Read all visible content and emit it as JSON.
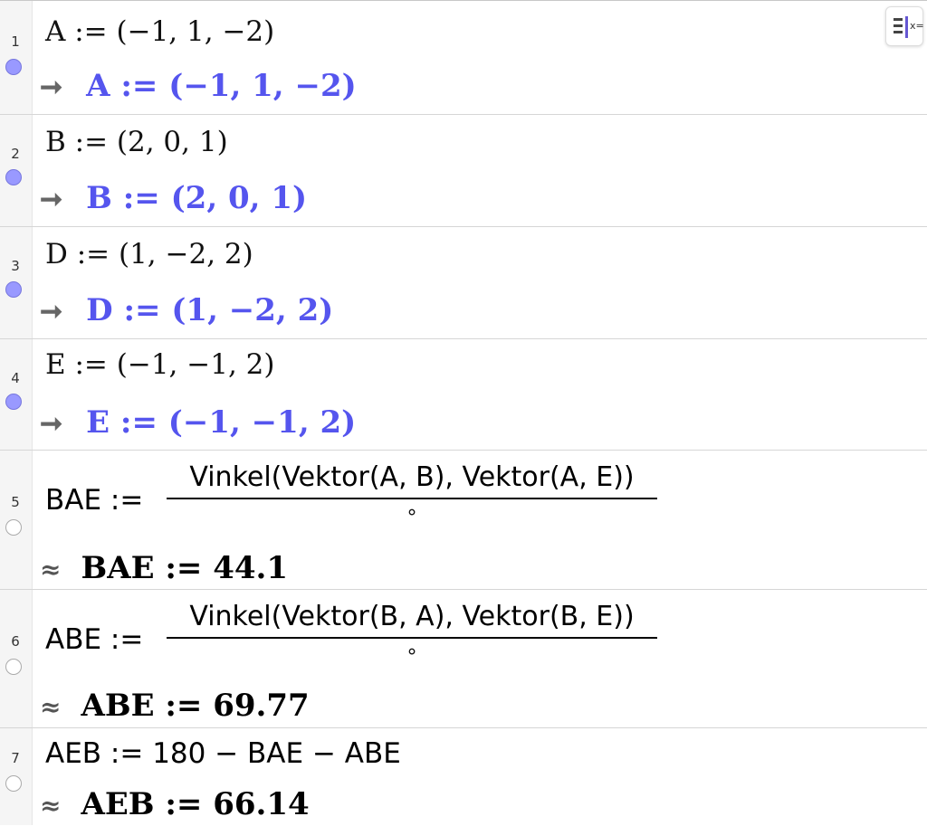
{
  "rows": [
    {
      "num": "1",
      "input": "A := (−1, 1, −2)",
      "output": "A := (−1, 1, −2)"
    },
    {
      "num": "2",
      "input": "B := (2, 0, 1)",
      "output": "B := (2, 0, 1)"
    },
    {
      "num": "3",
      "input": "D := (1, −2, 2)",
      "output": "D := (1, −2, 2)"
    },
    {
      "num": "4",
      "input": "E := (−1, −1, 2)",
      "output": "E := (−1, −1, 2)"
    },
    {
      "num": "5",
      "lhs": "BAE :=",
      "numerator": "Vinkel(Vektor(A, B), Vektor(A, E))",
      "denominator": "∘",
      "output": "BAE := 44.1"
    },
    {
      "num": "6",
      "lhs": "ABE :=",
      "numerator": "Vinkel(Vektor(B, A), Vektor(B, E))",
      "denominator": "∘",
      "output": "ABE := 69.77"
    },
    {
      "num": "7",
      "input": "AEB := 180 − BAE − ABE",
      "output": "AEB := 66.14"
    }
  ],
  "symbols": {
    "arrow": "➞",
    "approx": "≈"
  },
  "toolbar": {
    "label": "x="
  },
  "colors": {
    "accent": "#5555ee",
    "marble_on": "#9999ff"
  }
}
